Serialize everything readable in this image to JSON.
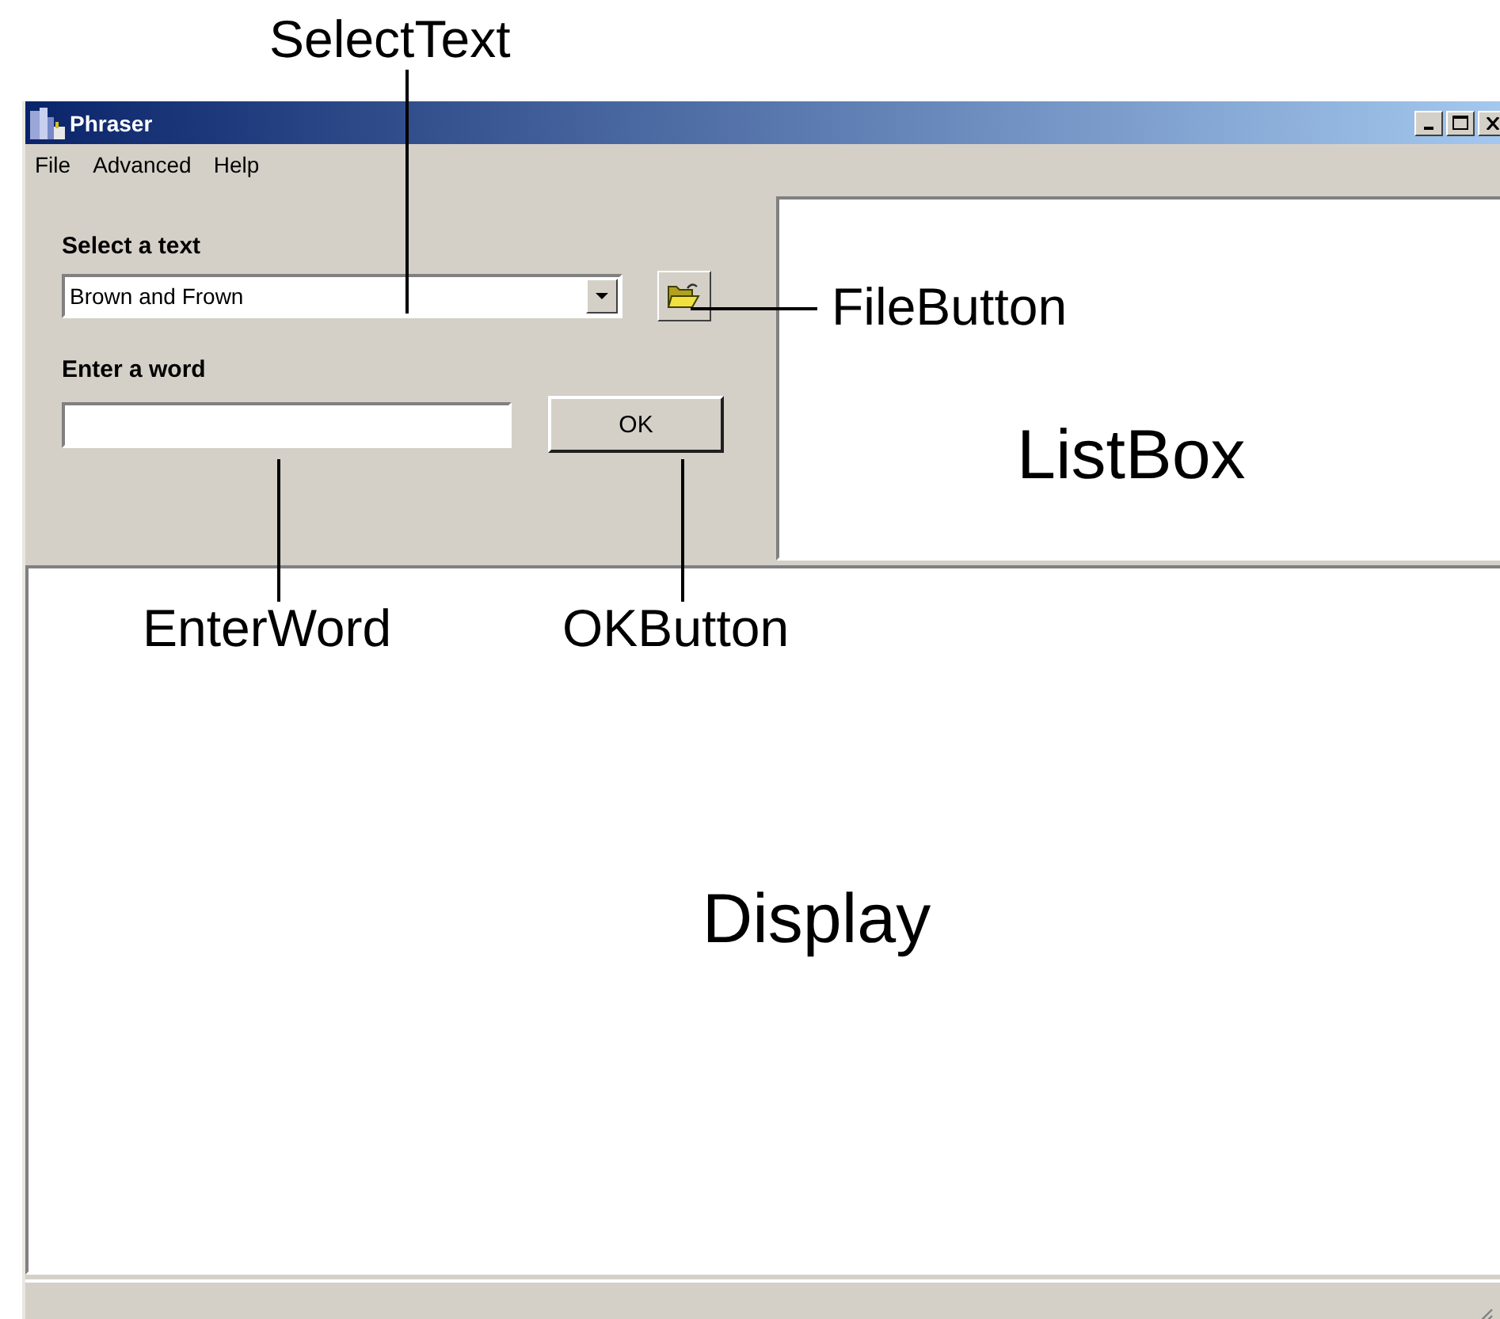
{
  "callouts": [
    {
      "text": "SelectText"
    },
    {
      "text": "FileButton"
    },
    {
      "text": "EnterWord"
    },
    {
      "text": "OKButton"
    }
  ],
  "window": {
    "title": "Phraser"
  },
  "menu": [
    "File",
    "Advanced",
    "Help"
  ],
  "select_label": "Select a text",
  "select": {
    "value": "Brown and Frown"
  },
  "word_label": "Enter a word",
  "ok_button": "OK",
  "listbox_label": "ListBox",
  "display_label": "Display"
}
